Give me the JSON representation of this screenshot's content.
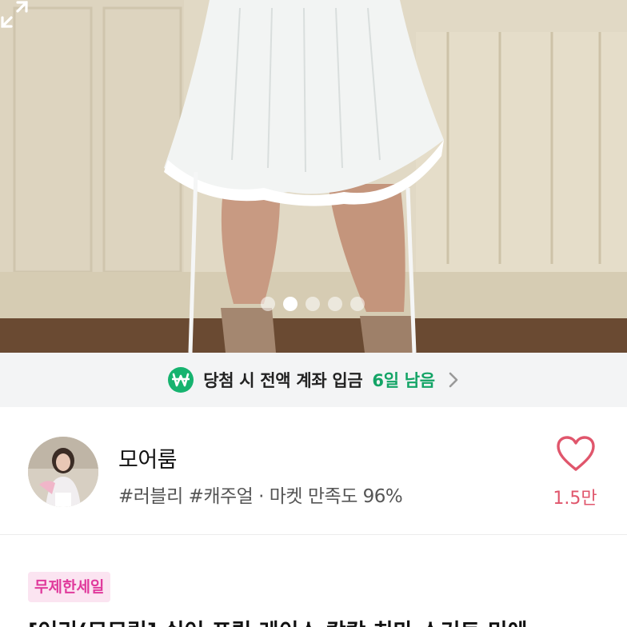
{
  "hero": {
    "image_subject": "white ruffled mini skirt worn with brown boots",
    "page_count": 5,
    "active_page": 2
  },
  "banner": {
    "text": "당첨 시 전액 계좌 입금",
    "days_left": "6일 남음",
    "icon": "won-icon",
    "accent": "#16b36f"
  },
  "seller": {
    "name": "모어룸",
    "tags": "#러블리 #캐주얼 · 마켓 만족도 96%",
    "likes": "1.5만",
    "heart_color": "#e0566c"
  },
  "product": {
    "badge": "무제한세일",
    "title": "[어리(모모링] 쉬어 프릴 레이스 캉캉 치마 스커트 미에"
  }
}
